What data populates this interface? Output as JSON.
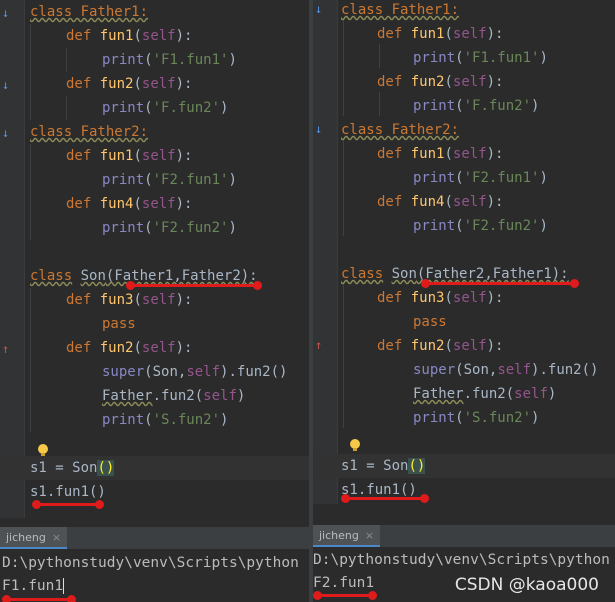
{
  "left": {
    "code": {
      "father1_class": "class Father1:",
      "father1_fun1_def": "def fun1(self):",
      "father1_fun1_print": "print('F1.fun1')",
      "father1_fun2_def": "def fun2(self):",
      "father1_fun2_print": "print('F.fun2')",
      "father2_class": "class Father2:",
      "father2_fun1_def": "def fun1(self):",
      "father2_fun1_print": "print('F2.fun1')",
      "father2_fun4_def": "def fun4(self):",
      "father2_fun4_print": "print('F2.fun2')",
      "son_class_kw": "class",
      "son_class_name": "Son",
      "son_bases": "(Father1,Father2):",
      "son_fun3_def": "def fun3(self):",
      "son_fun3_pass": "pass",
      "son_fun2_def": "def fun2(self):",
      "son_super_call": "super(Son,self).fun2()",
      "son_father_call": "Father.fun2(self)",
      "son_print": "print('S.fun2')",
      "instance_line_a": "s1 = Son",
      "instance_line_b": "()",
      "call_line": "s1.fun1()"
    },
    "run_tab": {
      "label": "jicheng",
      "close": "×"
    },
    "console": {
      "command": "D:\\pythonstudy\\venv\\Scripts\\python",
      "output": "F1.fun1"
    }
  },
  "right": {
    "code": {
      "father1_class": "class Father1:",
      "father1_fun1_def": "def fun1(self):",
      "father1_fun1_print": "print('F1.fun1')",
      "father1_fun2_def": "def fun2(self):",
      "father1_fun2_print": "print('F.fun2')",
      "father2_class": "class Father2:",
      "father2_fun1_def": "def fun1(self):",
      "father2_fun1_print": "print('F2.fun1')",
      "father2_fun4_def": "def fun4(self):",
      "father2_fun4_print": "print('F2.fun2')",
      "son_class_kw": "class",
      "son_class_name": "Son",
      "son_bases": "(Father2,Father1):",
      "son_fun3_def": "def fun3(self):",
      "son_fun3_pass": "pass",
      "son_fun2_def": "def fun2(self):",
      "son_super_call": "super(Son,self).fun2()",
      "son_father_call": "Father.fun2(self)",
      "son_print": "print('S.fun2')",
      "instance_line_a": "s1 = Son",
      "instance_line_b": "()",
      "call_line": "s1.fun1()"
    },
    "run_tab": {
      "label": "jicheng",
      "close": "×"
    },
    "console": {
      "command": "D:\\pythonstudy\\venv\\Scripts\\python",
      "output": "F2.fun1"
    }
  },
  "watermark": "CSDN @kaoa000",
  "colors": {
    "background": "#2b2b2b",
    "keyword": "#cc7832",
    "function": "#ffc66d",
    "self": "#94558d",
    "string": "#6a8759",
    "annotation": "#e01b1b"
  }
}
